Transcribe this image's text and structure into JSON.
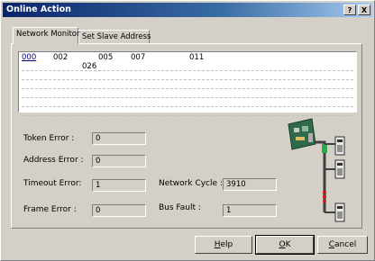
{
  "window": {
    "title": "Online Action",
    "help_glyph": "?",
    "close_glyph": "X"
  },
  "tabs": [
    {
      "label": "Network Monitor",
      "active": true
    },
    {
      "label": "Set Slave Address",
      "active": false
    }
  ],
  "monitor": {
    "addresses_row1": [
      "000",
      "002",
      "005",
      "007",
      "011"
    ],
    "addresses_row2": [
      "026"
    ],
    "selected": "000"
  },
  "status": {
    "token_error": {
      "label": "Token Error :",
      "value": "0"
    },
    "address_error": {
      "label": "Address Error :",
      "value": "0"
    },
    "timeout_error": {
      "label": "Timeout Error:",
      "value": "1"
    },
    "frame_error": {
      "label": "Frame Error :",
      "value": "0"
    },
    "network_cycle": {
      "label": "Network Cycle :",
      "value": "3910"
    },
    "bus_fault": {
      "label": "Bus Fault :",
      "value": "1"
    }
  },
  "buttons": {
    "help": {
      "mnemonic": "H",
      "rest": "elp"
    },
    "ok": {
      "mnemonic": "O",
      "rest": "K"
    },
    "cancel": {
      "mnemonic": "C",
      "rest": "ancel"
    }
  },
  "icons": {
    "network_diagram": "network-topology-icon"
  }
}
